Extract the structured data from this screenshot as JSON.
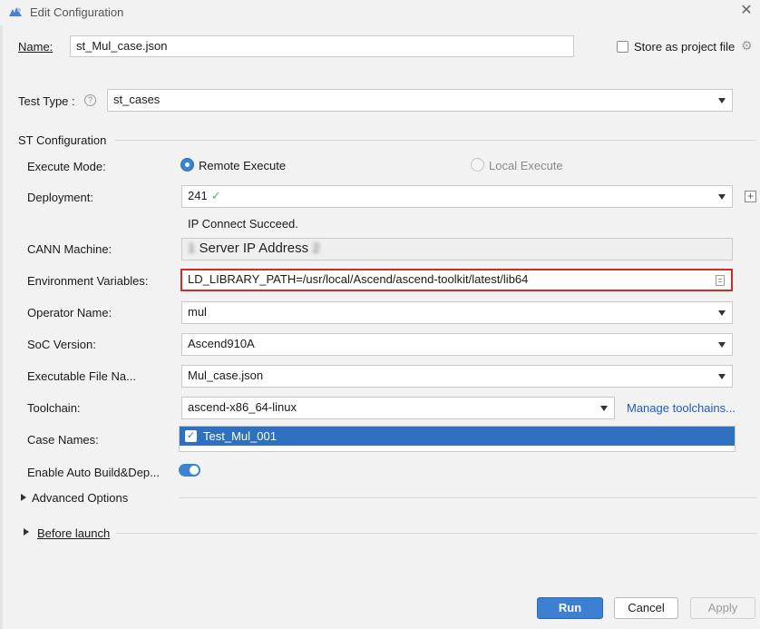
{
  "window": {
    "title": "Edit Configuration",
    "app_icon": "app-logo-icon",
    "close_icon": "close-icon"
  },
  "header": {
    "name_label": "Name:",
    "name_value": "st_Mul_case.json",
    "store_label": "Store as project file",
    "store_checked": false,
    "gear_icon": "gear-icon"
  },
  "test_type": {
    "label": "Test Type :",
    "value": "st_cases",
    "help_icon": "help-icon"
  },
  "st_config": {
    "section_label": "ST Configuration",
    "execute_mode": {
      "label": "Execute Mode:",
      "options": [
        "Remote Execute",
        "Local Execute"
      ],
      "selected": "Remote Execute"
    },
    "deployment": {
      "label": "Deployment:",
      "value": "241",
      "status": "IP Connect Succeed.",
      "add_icon": "plus-icon"
    },
    "cann_machine": {
      "label": "CANN Machine:",
      "value": "Server IP Address",
      "blur_left": "1",
      "blur_right": "2"
    },
    "env_vars": {
      "label": "Environment Variables:",
      "value": "LD_LIBRARY_PATH=/usr/local/Ascend/ascend-toolkit/latest/lib64"
    },
    "operator_name": {
      "label": "Operator Name:",
      "value": "mul"
    },
    "soc_version": {
      "label": "SoC Version:",
      "value": "Ascend910A"
    },
    "executable": {
      "label": "Executable File Na...",
      "value": "Mul_case.json"
    },
    "toolchain": {
      "label": "Toolchain:",
      "value": "ascend-x86_64-linux",
      "manage_link": "Manage toolchains..."
    },
    "case_names": {
      "label": "Case Names:",
      "items": [
        "Test_Mul_001"
      ]
    },
    "auto_build": {
      "label": "Enable Auto Build&Dep...",
      "enabled": true
    }
  },
  "advanced_options": {
    "label": "Advanced Options"
  },
  "before_launch": {
    "label": "Before launch"
  },
  "buttons": {
    "run": "Run",
    "cancel": "Cancel",
    "apply": "Apply"
  },
  "colors": {
    "accent": "#3d84d0",
    "link": "#2159c5",
    "error_border": "#d22b2b",
    "success": "#3fba6e"
  }
}
